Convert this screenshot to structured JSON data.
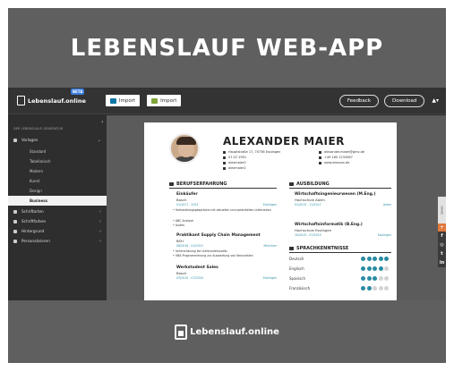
{
  "hero": {
    "title": "LEBENSLAUF WEB-APP"
  },
  "app": {
    "logo_text": "Lebenslauf.online",
    "beta_badge": "BETA",
    "import_buttons": [
      {
        "label": "Import",
        "icon": "linkedin-icon"
      },
      {
        "label": "Import",
        "icon": "xing-icon"
      }
    ],
    "feedback_label": "Feedback",
    "download_label": "Download",
    "user_label": "▲▾",
    "collapse_label": "‹"
  },
  "sidebar": {
    "heading": "DER LEBENSLAUF-GENERATOR",
    "items": [
      {
        "label": "Vorlagen",
        "icon": "template-icon",
        "expanded": true
      },
      {
        "label": "Schriftarten",
        "icon": "font-icon"
      },
      {
        "label": "Schriftfarben",
        "icon": "color-icon"
      },
      {
        "label": "Hintergrund",
        "icon": "background-icon"
      },
      {
        "label": "Personalisieren",
        "icon": "personalize-icon"
      }
    ],
    "templates": [
      "Standard",
      "Tabellarisch",
      "Modern",
      "Kunst",
      "Design",
      "Business"
    ],
    "active_template": "Business"
  },
  "resume": {
    "name": "ALEXANDER MAIER",
    "contacts": [
      "Hauptstraße 17, 70736 Esslingen",
      "07.07.1991",
      "alexmaier0",
      "alexmaier2",
      "alexander.maier@gmx.de",
      "+49 160 1234567",
      "www.alexxxx.de"
    ],
    "experience_heading": "BERUFSERFAHRUNG",
    "experience": [
      {
        "title": "Einkäufer",
        "company": "Bosch",
        "dates": "01/2017 - 2021",
        "location": "Esslingen",
        "bullets": [
          "Verhandlungsgespräche mit aktuellen und potentiellen Lieferanten",
          "ABC Analyse",
          "Audits"
        ]
      },
      {
        "title": "Praktikant Supply Chain Management",
        "company": "BSH",
        "dates": "08/2016 - 01/2015",
        "location": "München",
        "bullets": [
          "Unterstützung bei Lieferantenaudits",
          "VBA Programmierung zur Auswertung von Kennzahlen"
        ]
      },
      {
        "title": "Werkstudent Sales",
        "company": "Bosch",
        "dates": "03/2015 - 07/2016",
        "location": "Esslingen",
        "bullets": []
      }
    ],
    "education_heading": "AUSBILDUNG",
    "education": [
      {
        "title": "Wirtschaftsingenieurwesen (M.Eng.)",
        "school": "Hochschule Aalen",
        "dates": "01/2015 - 12/2017",
        "location": "Aalen"
      },
      {
        "title": "Wirtschaftsinformatik (B.Eng.)",
        "school": "Hochschule Esslingen",
        "dates": "10/2015 - 07/2015",
        "location": "Esslingen"
      }
    ],
    "languages_heading": "SPRACHKENNTNISSE",
    "languages": [
      {
        "name": "Deutsch",
        "level": 5
      },
      {
        "name": "Englisch",
        "level": 4
      },
      {
        "name": "Spanisch",
        "level": 3
      },
      {
        "name": "Französisch",
        "level": 2
      }
    ]
  },
  "share_rail": {
    "label": "SHARE",
    "icons": [
      "plus-icon",
      "facebook-icon",
      "instagram-icon",
      "twitter-icon",
      "linkedin-icon"
    ],
    "glyphs": [
      "+",
      "f",
      "◎",
      "t",
      "in"
    ]
  },
  "footer": {
    "brand": "Lebenslauf.online"
  },
  "colors": {
    "accent": "#2a8aa3",
    "panel": "#2b2b2b",
    "background": "#5f5f5f"
  }
}
